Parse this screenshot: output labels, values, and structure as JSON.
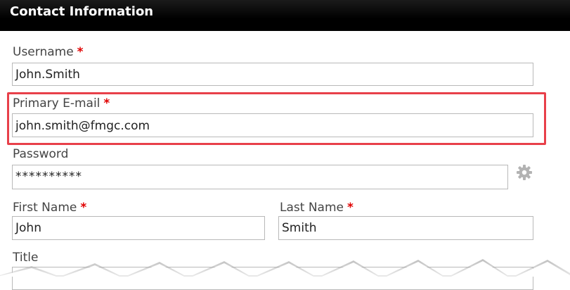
{
  "header": {
    "title": "Contact Information"
  },
  "form": {
    "username": {
      "label": "Username",
      "required": "*",
      "value": "John.Smith"
    },
    "email": {
      "label": "Primary E-mail",
      "required": "*",
      "value": "john.smith@fmgc.com"
    },
    "password": {
      "label": "Password",
      "value": "**********",
      "icon": "gear-icon"
    },
    "first_name": {
      "label": "First Name",
      "required": "*",
      "value": "John"
    },
    "last_name": {
      "label": "Last Name",
      "required": "*",
      "value": "Smith"
    },
    "title": {
      "label": "Title"
    }
  },
  "colors": {
    "header_bg": "#000000",
    "header_text": "#ffffff",
    "required": "#e00000",
    "highlight_border": "#e8404a",
    "input_border": "#b9b9b9"
  }
}
